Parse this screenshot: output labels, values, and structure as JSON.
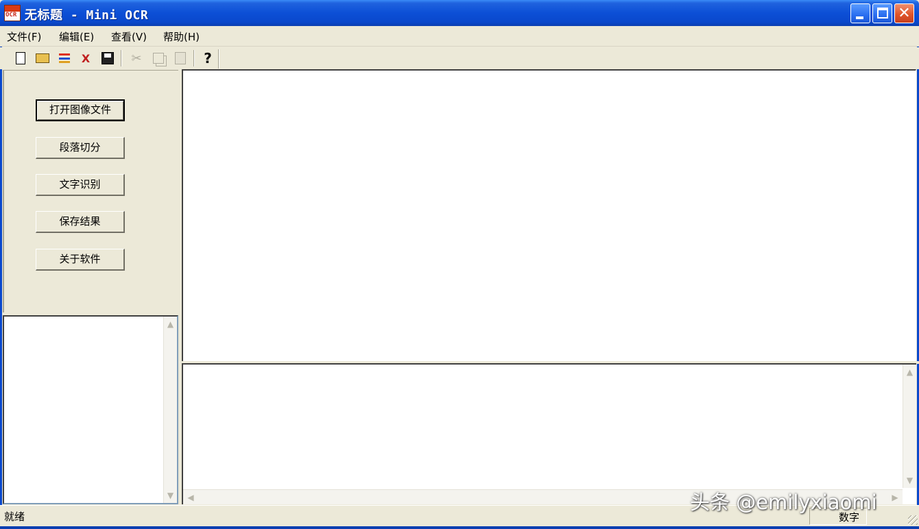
{
  "window": {
    "title": "无标题 - Mini OCR",
    "icon_label": "OCR",
    "controls": [
      "minimize-icon",
      "maximize-icon",
      "close-icon"
    ]
  },
  "menu": {
    "items": [
      {
        "label": "文件(F)"
      },
      {
        "label": "编辑(E)"
      },
      {
        "label": "查看(V)"
      },
      {
        "label": "帮助(H)"
      }
    ]
  },
  "toolbar": {
    "buttons": [
      {
        "icon": "new-file-icon",
        "glyph": "🗋"
      },
      {
        "icon": "open-folder-icon",
        "glyph": "📂"
      },
      {
        "icon": "segment-icon",
        "glyph": "≡"
      },
      {
        "icon": "recognize-icon",
        "glyph": "✂"
      },
      {
        "icon": "save-icon",
        "glyph": "💾"
      },
      {
        "icon": "cut-icon",
        "glyph": "✂"
      },
      {
        "icon": "copy-icon",
        "glyph": "⧉"
      },
      {
        "icon": "paste-icon",
        "glyph": "📋"
      },
      {
        "icon": "help-icon",
        "glyph": "?"
      }
    ]
  },
  "left_panel": {
    "buttons": [
      {
        "label": "打开图像文件"
      },
      {
        "label": "段落切分"
      },
      {
        "label": "文字识别"
      },
      {
        "label": "保存结果"
      },
      {
        "label": "关于软件"
      }
    ]
  },
  "statusbar": {
    "text": "就绪",
    "indicator": "数字"
  },
  "watermark": {
    "text": "头条 @emilyxiaomi"
  }
}
